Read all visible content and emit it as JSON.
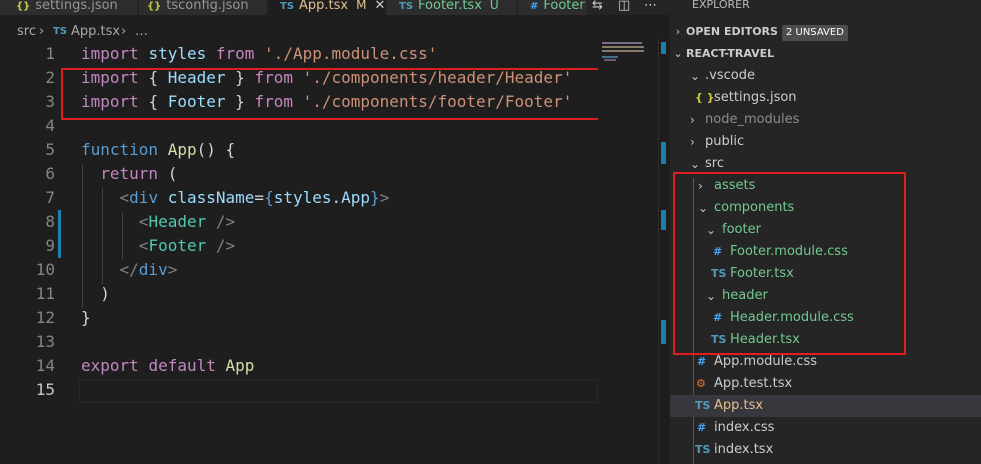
{
  "tabs": [
    {
      "icon": "{}",
      "label": "settings.json",
      "status": ""
    },
    {
      "icon": "{}",
      "label": "tsconfig.json",
      "status": ""
    },
    {
      "icon": "TS",
      "label": "App.tsx",
      "status": "M"
    },
    {
      "icon": "TS",
      "label": "Footer.tsx",
      "status": "U"
    },
    {
      "icon": "#",
      "label": "Footer",
      "status": ""
    }
  ],
  "breadcrumb": {
    "folder": "src",
    "sep": "›",
    "file_icon": "TS",
    "file": "App.tsx",
    "more": "…"
  },
  "code": {
    "line_numbers": [
      "1",
      "2",
      "3",
      "4",
      "5",
      "6",
      "7",
      "8",
      "9",
      "10",
      "11",
      "12",
      "13",
      "14",
      "15"
    ],
    "l1": {
      "import": "import",
      "name": "styles",
      "from": "from",
      "path": "'./App.module.css'"
    },
    "l2": {
      "import": "import",
      "open": "{",
      "name": "Header",
      "close": "}",
      "from": "from",
      "path": "'./components/header/Header'"
    },
    "l3": {
      "import": "import",
      "open": "{",
      "name": "Footer",
      "close": "}",
      "from": "from",
      "path": "'./components/footer/Footer'"
    },
    "l5": {
      "function": "function",
      "name": "App",
      "rest": "() {"
    },
    "l6": {
      "return": "return",
      "rest": "("
    },
    "l7": {
      "open": "<",
      "tag": "div",
      "attr": "className",
      "eq": "=",
      "expr_open": "{",
      "obj": "styles",
      "dot": ".",
      "prop": "App",
      "expr_close": "}",
      "close": ">"
    },
    "l8": {
      "open": "<",
      "tag": "Header",
      "close": " />"
    },
    "l9": {
      "open": "<",
      "tag": "Footer",
      "close": " />"
    },
    "l10": {
      "open": "</",
      "tag": "div",
      "close": ">"
    },
    "l11": {
      "text": ")"
    },
    "l12": {
      "text": "}"
    },
    "l14": {
      "export": "export",
      "default": "default",
      "name": "App"
    }
  },
  "explorer": {
    "title": "EXPLORER",
    "open_editors_label": "OPEN EDITORS",
    "unsaved_badge": "2 UNSAVED",
    "project_label": "REACT-TRAVEL",
    "items": [
      {
        "label": ".vscode",
        "icon": "",
        "color": "#cccccc"
      },
      {
        "label": "settings.json",
        "icon": "{ }",
        "color": "#cccccc"
      },
      {
        "label": "node_modules",
        "icon": "",
        "color": "#8c8c8c"
      },
      {
        "label": "public",
        "icon": "",
        "color": "#cccccc"
      },
      {
        "label": "src",
        "icon": "",
        "color": "#cccccc"
      },
      {
        "label": "assets",
        "icon": "",
        "color": "#73c991"
      },
      {
        "label": "components",
        "icon": "",
        "color": "#73c991"
      },
      {
        "label": "footer",
        "icon": "",
        "color": "#73c991"
      },
      {
        "label": "Footer.module.css",
        "icon": "#",
        "color": "#73c991"
      },
      {
        "label": "Footer.tsx",
        "icon": "TS",
        "color": "#73c991"
      },
      {
        "label": "header",
        "icon": "",
        "color": "#73c991"
      },
      {
        "label": "Header.module.css",
        "icon": "#",
        "color": "#73c991"
      },
      {
        "label": "Header.tsx",
        "icon": "TS",
        "color": "#73c991"
      },
      {
        "label": "App.module.css",
        "icon": "#",
        "color": "#cccccc"
      },
      {
        "label": "App.test.tsx",
        "icon": "⚙",
        "color": "#cccccc"
      },
      {
        "label": "App.tsx",
        "icon": "TS",
        "color": "#e2c08d"
      },
      {
        "label": "index.css",
        "icon": "#",
        "color": "#cccccc"
      },
      {
        "label": "index.tsx",
        "icon": "TS",
        "color": "#cccccc"
      }
    ]
  },
  "colors": {
    "highlight_box": "#e01e1e",
    "ts_icon": "#519aba",
    "css_icon": "#42a5f5",
    "json_icon": "#cbcb41",
    "test_icon": "#e37933"
  }
}
